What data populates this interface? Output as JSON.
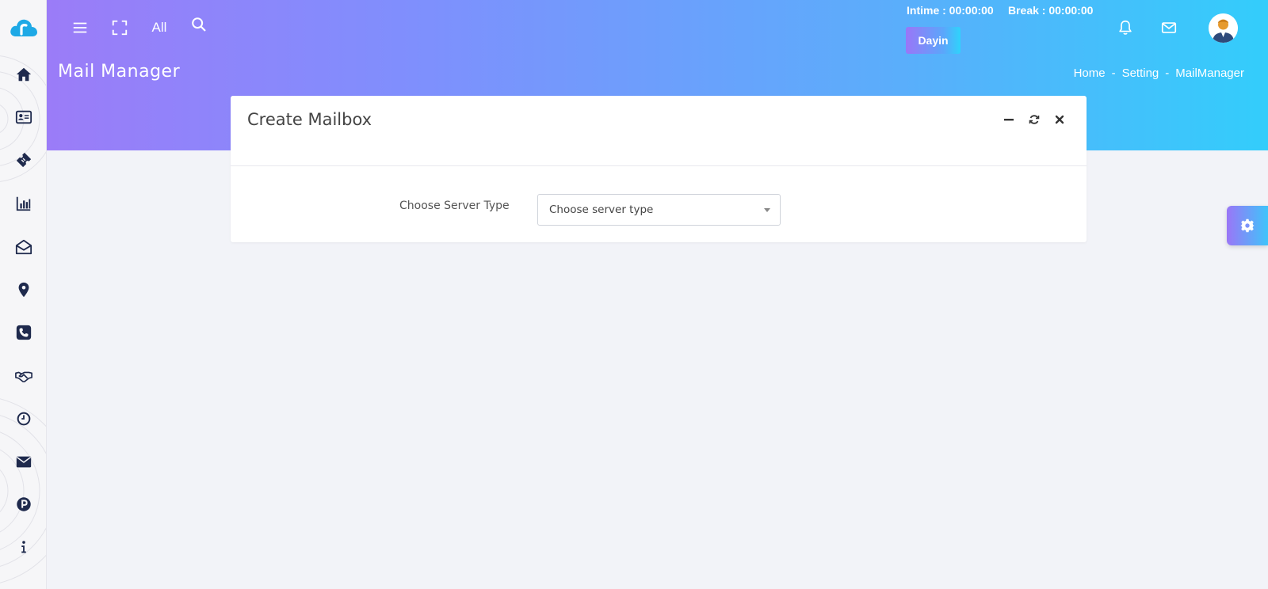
{
  "header": {
    "search_scope": "All",
    "intime": "Intime : 00:00:00",
    "break": "Break : 00:00:00",
    "user_name": "Dayin",
    "page_title": "Mail Manager",
    "breadcrumb": {
      "home": "Home",
      "sep1": "-",
      "setting": "Setting",
      "sep2": "-",
      "current": "MailManager"
    }
  },
  "sidebar": {
    "items": [
      {
        "icon": "home-icon"
      },
      {
        "icon": "contact-card-icon"
      },
      {
        "icon": "ticket-icon"
      },
      {
        "icon": "bar-chart-icon"
      },
      {
        "icon": "mail-open-icon"
      },
      {
        "icon": "location-pin-icon"
      },
      {
        "icon": "phone-icon"
      },
      {
        "icon": "handshake-icon"
      },
      {
        "icon": "clock-icon"
      },
      {
        "icon": "envelope-icon"
      },
      {
        "icon": "parking-icon"
      },
      {
        "icon": "info-icon"
      }
    ]
  },
  "card": {
    "title": "Create Mailbox",
    "field_label": "Choose Server Type",
    "select_value": "Choose server type"
  },
  "colors": {
    "accent_purple": "#9b7cf8",
    "accent_cyan": "#33cdfb",
    "icon_dark": "#1f2a4d",
    "page_bg": "#f2f3f8"
  }
}
